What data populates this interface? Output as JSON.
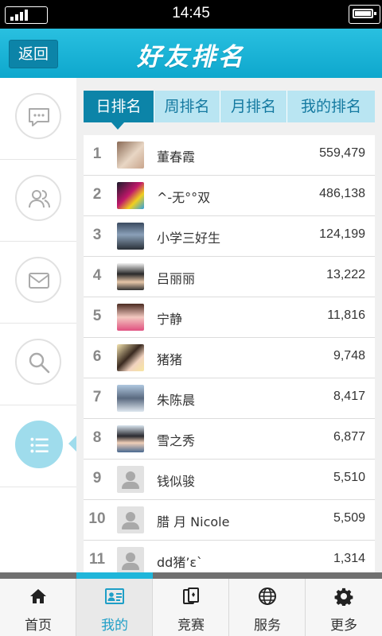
{
  "status": {
    "time": "14:45"
  },
  "header": {
    "back_label": "返回",
    "title": "好友排名"
  },
  "sidebar": {
    "items": [
      {
        "icon": "chat-bubble-icon"
      },
      {
        "icon": "friends-icon"
      },
      {
        "icon": "mail-icon"
      },
      {
        "icon": "search-icon"
      },
      {
        "icon": "list-icon"
      }
    ]
  },
  "tabs": [
    "日排名",
    "周排名",
    "月排名",
    "我的排名"
  ],
  "ranking": [
    {
      "rank": "1",
      "name": "董春霞",
      "score": "559,479",
      "avatar": "photo"
    },
    {
      "rank": "2",
      "name": "^-无°°双",
      "score": "486,138",
      "avatar": "photo"
    },
    {
      "rank": "3",
      "name": "小学三好生",
      "score": "124,199",
      "avatar": "photo"
    },
    {
      "rank": "4",
      "name": "吕丽丽",
      "score": "13,222",
      "avatar": "photo"
    },
    {
      "rank": "5",
      "name": "宁静",
      "score": "11,816",
      "avatar": "photo"
    },
    {
      "rank": "6",
      "name": "猪猪",
      "score": "9,748",
      "avatar": "photo"
    },
    {
      "rank": "7",
      "name": "朱陈晨",
      "score": "8,417",
      "avatar": "photo"
    },
    {
      "rank": "8",
      "name": "雪之秀",
      "score": "6,877",
      "avatar": "photo"
    },
    {
      "rank": "9",
      "name": "钱似骏",
      "score": "5,510",
      "avatar": "default"
    },
    {
      "rank": "10",
      "name": "腊 月 Nicole",
      "score": "5,509",
      "avatar": "default"
    },
    {
      "rank": "11",
      "name": "dd猪’ε`",
      "score": "1,314",
      "avatar": "default"
    }
  ],
  "bottom_nav": [
    "首页",
    "我的",
    "竞赛",
    "服务",
    "更多"
  ],
  "colors": {
    "accent": "#0ea7cd",
    "tab_active": "#0c84a8",
    "tab_inactive": "#b9e5f2"
  }
}
